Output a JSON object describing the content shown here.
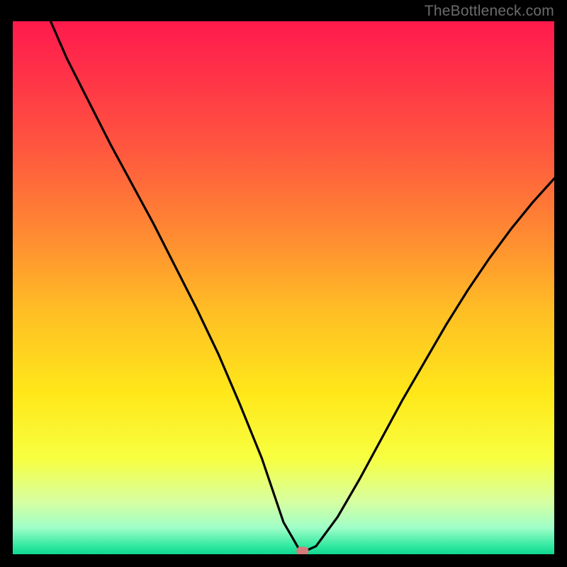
{
  "watermark": "TheBottleneck.com",
  "colors": {
    "background": "#000000",
    "gradient_stops": [
      {
        "offset": 0.0,
        "color": "#ff1a4d"
      },
      {
        "offset": 0.1,
        "color": "#ff3248"
      },
      {
        "offset": 0.25,
        "color": "#ff5a3e"
      },
      {
        "offset": 0.4,
        "color": "#ff8a32"
      },
      {
        "offset": 0.55,
        "color": "#ffc024"
      },
      {
        "offset": 0.7,
        "color": "#ffe81a"
      },
      {
        "offset": 0.82,
        "color": "#f7ff40"
      },
      {
        "offset": 0.9,
        "color": "#d8ffa0"
      },
      {
        "offset": 0.95,
        "color": "#a0ffc8"
      },
      {
        "offset": 0.985,
        "color": "#30e8a0"
      },
      {
        "offset": 1.0,
        "color": "#10d890"
      }
    ],
    "curve": "#000000",
    "marker": "#d77a7a"
  },
  "chart_data": {
    "type": "line",
    "title": "",
    "xlabel": "",
    "ylabel": "",
    "xlim": [
      0,
      100
    ],
    "ylim": [
      0,
      100
    ],
    "x": [
      7,
      10,
      14,
      18,
      22,
      26,
      30,
      34,
      38,
      42,
      46,
      48,
      50,
      52,
      53,
      54,
      56,
      60,
      64,
      68,
      72,
      76,
      80,
      84,
      88,
      92,
      96,
      100
    ],
    "values": [
      100,
      93,
      85,
      77,
      69.5,
      62,
      54,
      46,
      37.5,
      28,
      18,
      12,
      6,
      2.5,
      0.7,
      0.6,
      1.5,
      7,
      14,
      21.5,
      29,
      36,
      43,
      49.5,
      55.5,
      61,
      66,
      70.5
    ],
    "marker": {
      "x": 53.5,
      "y": 0.6
    },
    "annotations": []
  }
}
